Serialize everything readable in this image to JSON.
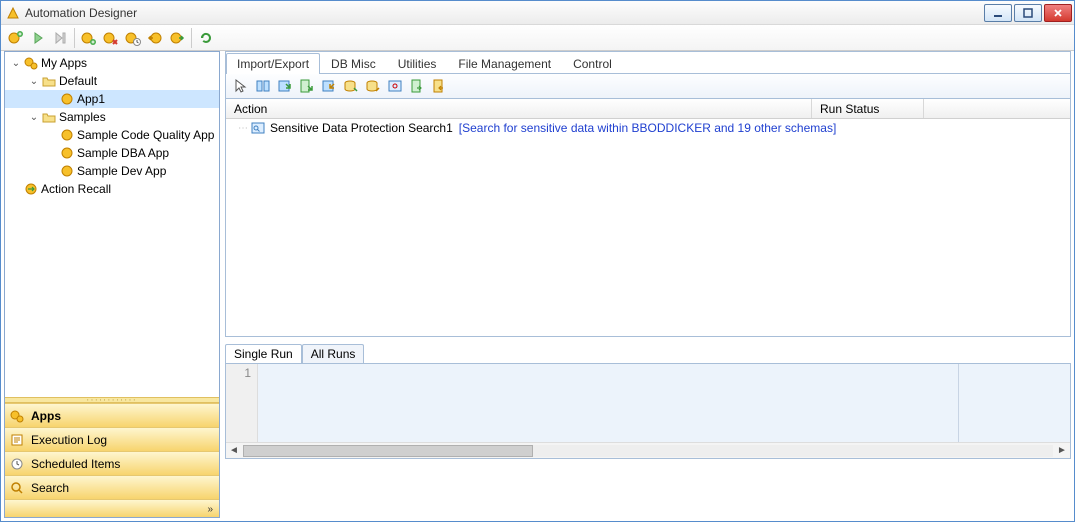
{
  "window": {
    "title": "Automation Designer"
  },
  "tree": {
    "root": "My Apps",
    "default_folder": "Default",
    "app1": "App1",
    "samples_folder": "Samples",
    "sample_code": "Sample Code Quality App",
    "sample_dba": "Sample DBA App",
    "sample_dev": "Sample Dev App",
    "action_recall": "Action Recall"
  },
  "nav": {
    "apps": "Apps",
    "execution_log": "Execution Log",
    "scheduled_items": "Scheduled Items",
    "search": "Search"
  },
  "tabs": {
    "import_export": "Import/Export",
    "db_misc": "DB Misc",
    "utilities": "Utilities",
    "file_management": "File Management",
    "control": "Control"
  },
  "grid": {
    "col_action": "Action",
    "col_status": "Run Status",
    "row1_name": "Sensitive Data Protection Search1",
    "row1_desc": "[Search for sensitive data within BBODDICKER and 19 other schemas]"
  },
  "bottom_tabs": {
    "single_run": "Single Run",
    "all_runs": "All Runs"
  },
  "output": {
    "line1": "1"
  }
}
